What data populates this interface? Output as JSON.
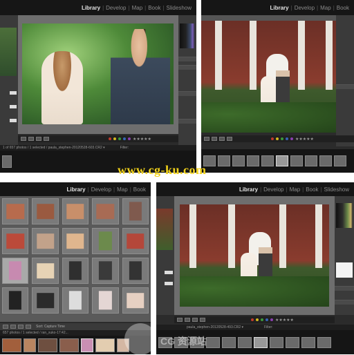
{
  "modules": [
    "Library",
    "Develop",
    "Map",
    "Book",
    "Slideshow"
  ],
  "panel_top_right_modules": [
    "Library",
    "Develop",
    "Map",
    "Book"
  ],
  "panel_bottom_left_modules": [
    "Library",
    "Develop",
    "Map",
    "Book"
  ],
  "panel_bottom_right_modules": [
    "Library",
    "Develop",
    "Map",
    "Book",
    "Slideshow"
  ],
  "active_module": "Library",
  "status_top_left": "1 of 657 photos / 1 selected / paula_stephen-20120528-603.CR2 ▾",
  "status_top_left_filter": "Filter:",
  "status_bottom_left": "657 photos / 1 selected / ran_xuko-17:42...",
  "status_bottom_left_sort": "Sort: Capture Time",
  "status_bottom_right": "paula_stephen-20120528-493.CR2 ▾",
  "status_bottom_right_filter": "Filter:",
  "stars": "★★★★★",
  "watermark": "www.cg-ku.com",
  "watermark_2": "CG 资源站",
  "accent_colors": {
    "red": "#c0392b",
    "yellow": "#d4b91e",
    "green": "#3a9a3a",
    "blue": "#3765b8",
    "purple": "#8a3fb0"
  }
}
